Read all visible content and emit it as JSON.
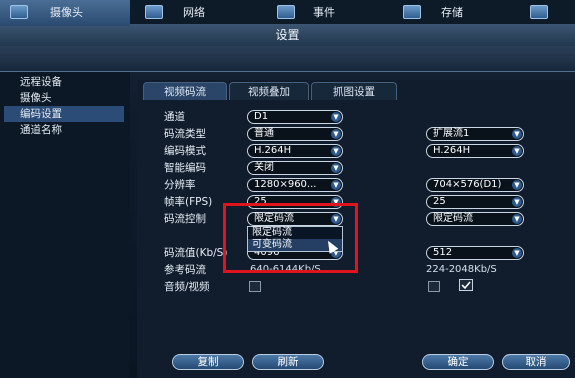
{
  "window": {
    "title": "设置"
  },
  "nav": {
    "camera": "摄像头",
    "network": "网络",
    "event": "事件",
    "storage": "存储"
  },
  "sidebar": {
    "items": [
      {
        "label": "远程设备"
      },
      {
        "label": "摄像头"
      },
      {
        "label": "编码设置"
      },
      {
        "label": "通道名称"
      }
    ]
  },
  "tabs": [
    {
      "label": "视频码流"
    },
    {
      "label": "视频叠加"
    },
    {
      "label": "抓图设置"
    }
  ],
  "form": {
    "channel": {
      "label": "通道",
      "value": "D1"
    },
    "stream_type": {
      "label": "码流类型",
      "main": "普通",
      "sub": "扩展流1"
    },
    "encode_mode": {
      "label": "编码模式",
      "main": "H.264H",
      "sub": "H.264H"
    },
    "smart_encode": {
      "label": "智能编码",
      "main": "关闭"
    },
    "resolution": {
      "label": "分辨率",
      "main": "1280×960...",
      "sub": "704×576(D1)"
    },
    "fps": {
      "label": "帧率(FPS)",
      "main": "25",
      "sub": "25"
    },
    "bitrate_control": {
      "label": "码流控制",
      "main": "限定码流",
      "sub": "限定码流"
    },
    "bitrate_value": {
      "label": "码流值(Kb/S)",
      "main": "4096",
      "sub": "512"
    },
    "ref_bitrate": {
      "label": "参考码流",
      "main": "640-6144Kb/S",
      "sub": "224-2048Kb/S"
    },
    "audio_video": {
      "label": "音频/视频"
    }
  },
  "dropdown": {
    "options": [
      "限定码流",
      "可变码流"
    ]
  },
  "buttons": {
    "copy": "复制",
    "refresh": "刷新",
    "ok": "确定",
    "cancel": "取消"
  },
  "colors": {
    "highlight_box": "#e0141c",
    "selected": "#2c4c78"
  }
}
